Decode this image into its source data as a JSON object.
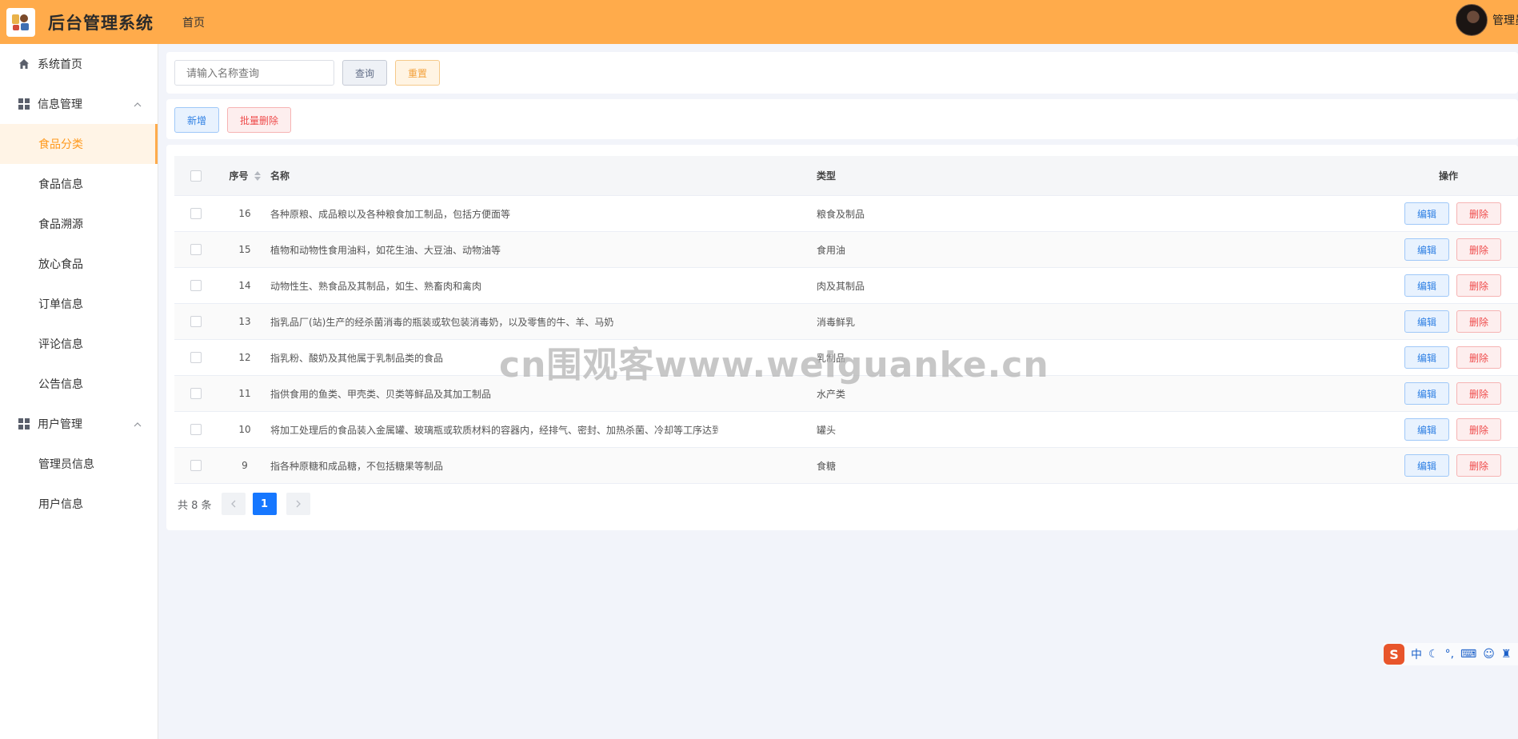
{
  "header": {
    "title": "后台管理系统",
    "breadcrumb": "首页",
    "user_name": "管理员"
  },
  "sidebar": {
    "home": "系统首页",
    "group_info": "信息管理",
    "info_items": [
      "食品分类",
      "食品信息",
      "食品溯源",
      "放心食品",
      "订单信息",
      "评论信息",
      "公告信息"
    ],
    "group_user": "用户管理",
    "user_items": [
      "管理员信息",
      "用户信息"
    ],
    "active": "食品分类"
  },
  "search": {
    "placeholder": "请输入名称查询",
    "query_label": "查询",
    "reset_label": "重置"
  },
  "actions": {
    "add_label": "新增",
    "batch_delete_label": "批量删除"
  },
  "table": {
    "columns": [
      "序号",
      "名称",
      "类型",
      "操作"
    ],
    "edit_label": "编辑",
    "delete_label": "删除",
    "rows": [
      {
        "id": "16",
        "name": "各种原粮、成品粮以及各种粮食加工制品，包括方便面等",
        "type": "粮食及制品"
      },
      {
        "id": "15",
        "name": "植物和动物性食用油料，如花生油、大豆油、动物油等",
        "type": "食用油"
      },
      {
        "id": "14",
        "name": "动物性生、熟食品及其制品，如生、熟畜肉和禽肉",
        "type": "肉及其制品"
      },
      {
        "id": "13",
        "name": "指乳品厂(站)生产的经杀菌消毒的瓶装或软包装消毒奶，以及零售的牛、羊、马奶",
        "type": "消毒鲜乳"
      },
      {
        "id": "12",
        "name": "指乳粉、酸奶及其他属于乳制品类的食品",
        "type": "乳制品"
      },
      {
        "id": "11",
        "name": "指供食用的鱼类、甲壳类、贝类等鲜品及其加工制品",
        "type": "水产类"
      },
      {
        "id": "10",
        "name": "将加工处理后的食品装入金属罐、玻璃瓶或软质材料的容器内，经排气、密封、加热杀菌、冷却等工序达到商业无菌的食品",
        "type": "罐头"
      },
      {
        "id": "9",
        "name": "指各种原糖和成品糖，不包括糖果等制品",
        "type": "食糖"
      }
    ]
  },
  "pagination": {
    "total_text": "共 8 条",
    "current_page": "1"
  },
  "watermark": "cn围观客www.weiguanke.cn",
  "ime": {
    "logo": "S",
    "mode": "中"
  },
  "colors": {
    "header": "#ffab4b",
    "active_menu": "#ff9a1f",
    "primary": "#1677ff",
    "danger": "#ef4b4b"
  }
}
